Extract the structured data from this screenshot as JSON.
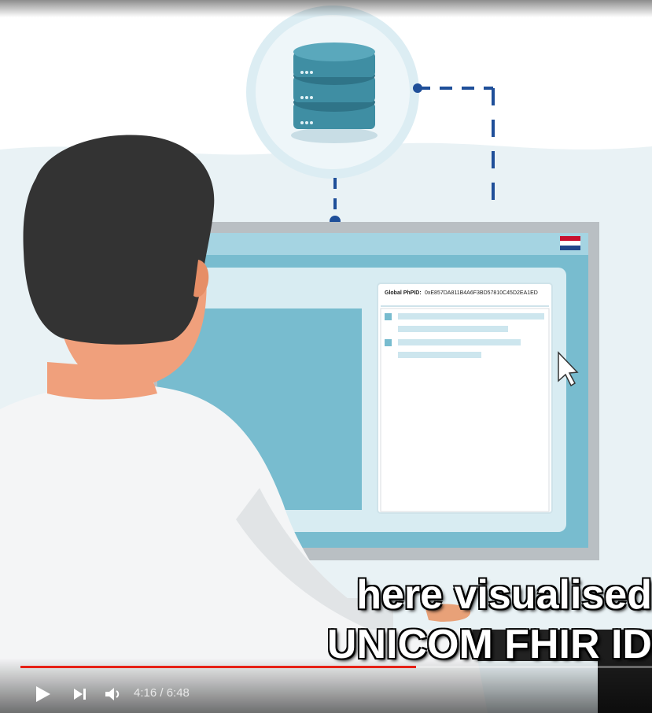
{
  "video": {
    "screen": {
      "pid_label": "Global PhPID:",
      "pid_value": "0xE857DA811B4A6F3BD57810C45D2EA1ED"
    },
    "captions": {
      "line1": "here visualised",
      "line2": "UNICOM FHIR ID"
    },
    "icons": {
      "database": "database-icon",
      "flag": "netherlands-flag-icon",
      "cursor": "mouse-cursor-icon",
      "play": "play-icon",
      "next": "next-icon",
      "volume": "volume-icon"
    },
    "colors": {
      "progress": "#e62117",
      "screen_blue": "#78bccf",
      "database": "#3f8ea3"
    }
  },
  "player": {
    "time_label": "4:16 / 6:48",
    "progress_fraction": 0.627
  }
}
